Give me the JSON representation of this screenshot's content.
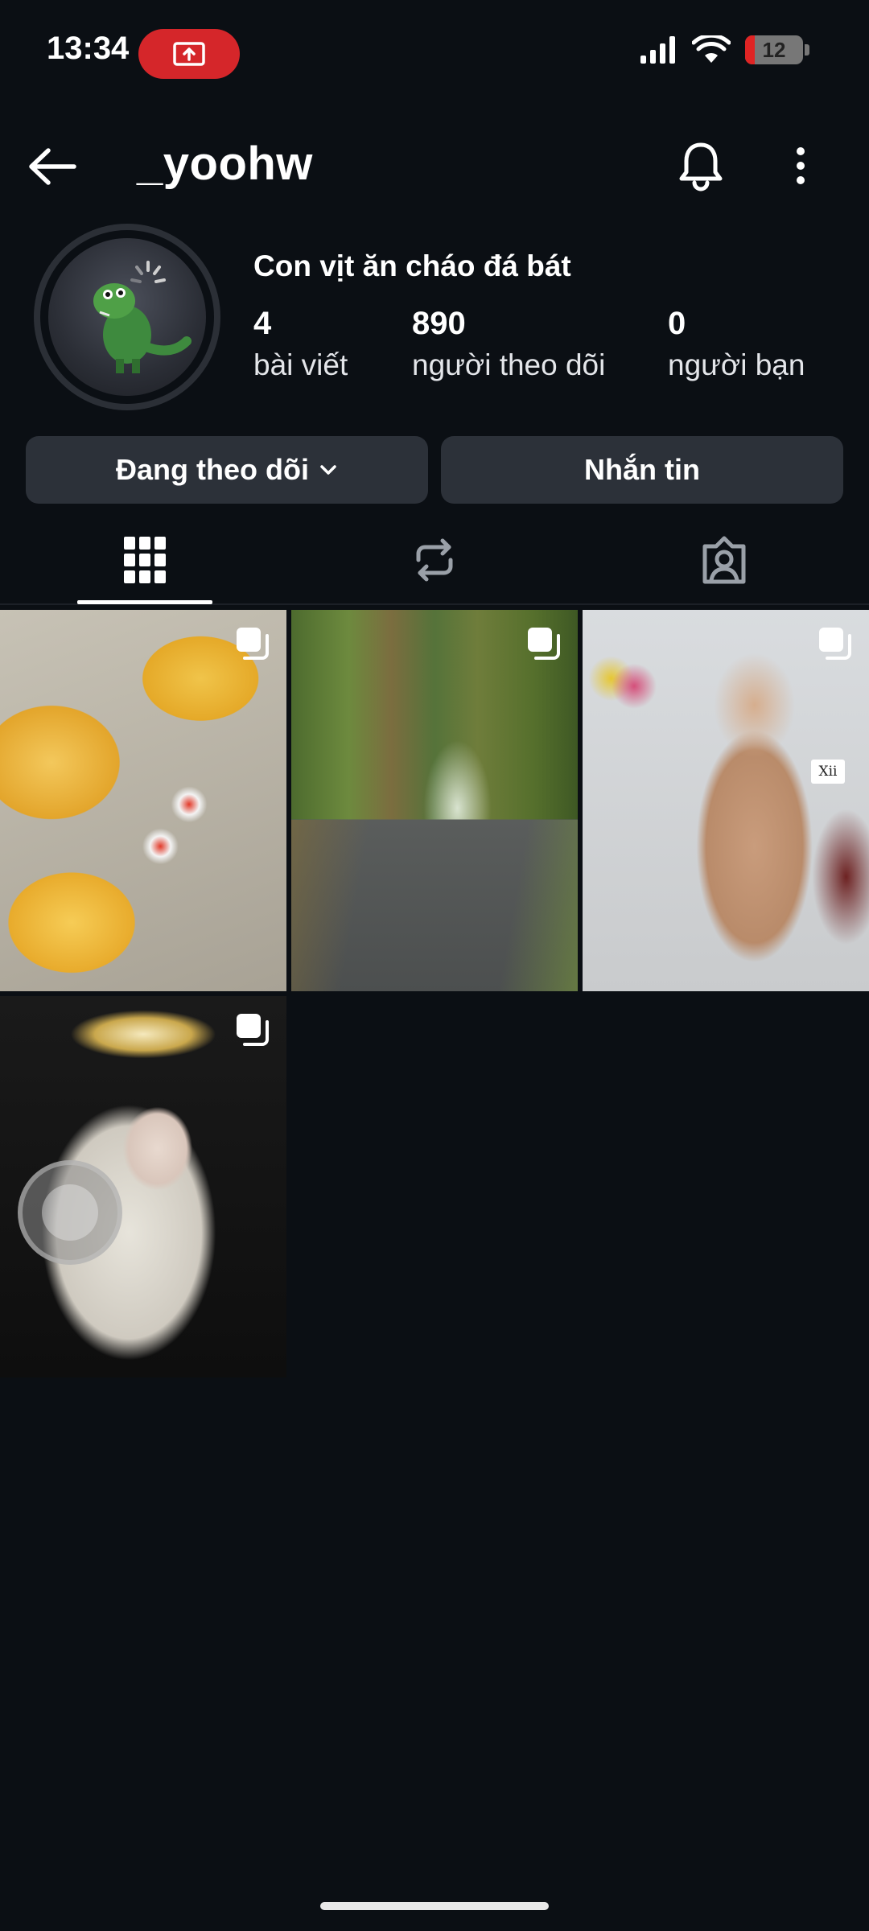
{
  "status_bar": {
    "time": "13:34",
    "battery_level": "12",
    "recording_color": "#d5262a"
  },
  "header": {
    "username": "_yoohw",
    "back_icon": "arrow-left-icon",
    "bell_icon": "bell-icon",
    "more_icon": "more-vertical-icon"
  },
  "profile": {
    "display_name": "Con vịt ăn cháo đá bát",
    "stats": [
      {
        "value": "4",
        "label": "bài viết"
      },
      {
        "value": "890",
        "label": "người theo dõi"
      },
      {
        "value": "0",
        "label": "người bạn"
      }
    ]
  },
  "actions": {
    "following_label": "Đang theo dõi",
    "message_label": "Nhắn tin"
  },
  "tabs": [
    {
      "icon": "grid-icon",
      "active": true
    },
    {
      "icon": "repost-icon",
      "active": false
    },
    {
      "icon": "tagged-icon",
      "active": false
    }
  ],
  "posts": {
    "tag_text": "Xii"
  },
  "colors": {
    "background": "#0b0f14",
    "button_bg": "#2c3139",
    "accent_white": "#ffffff"
  }
}
